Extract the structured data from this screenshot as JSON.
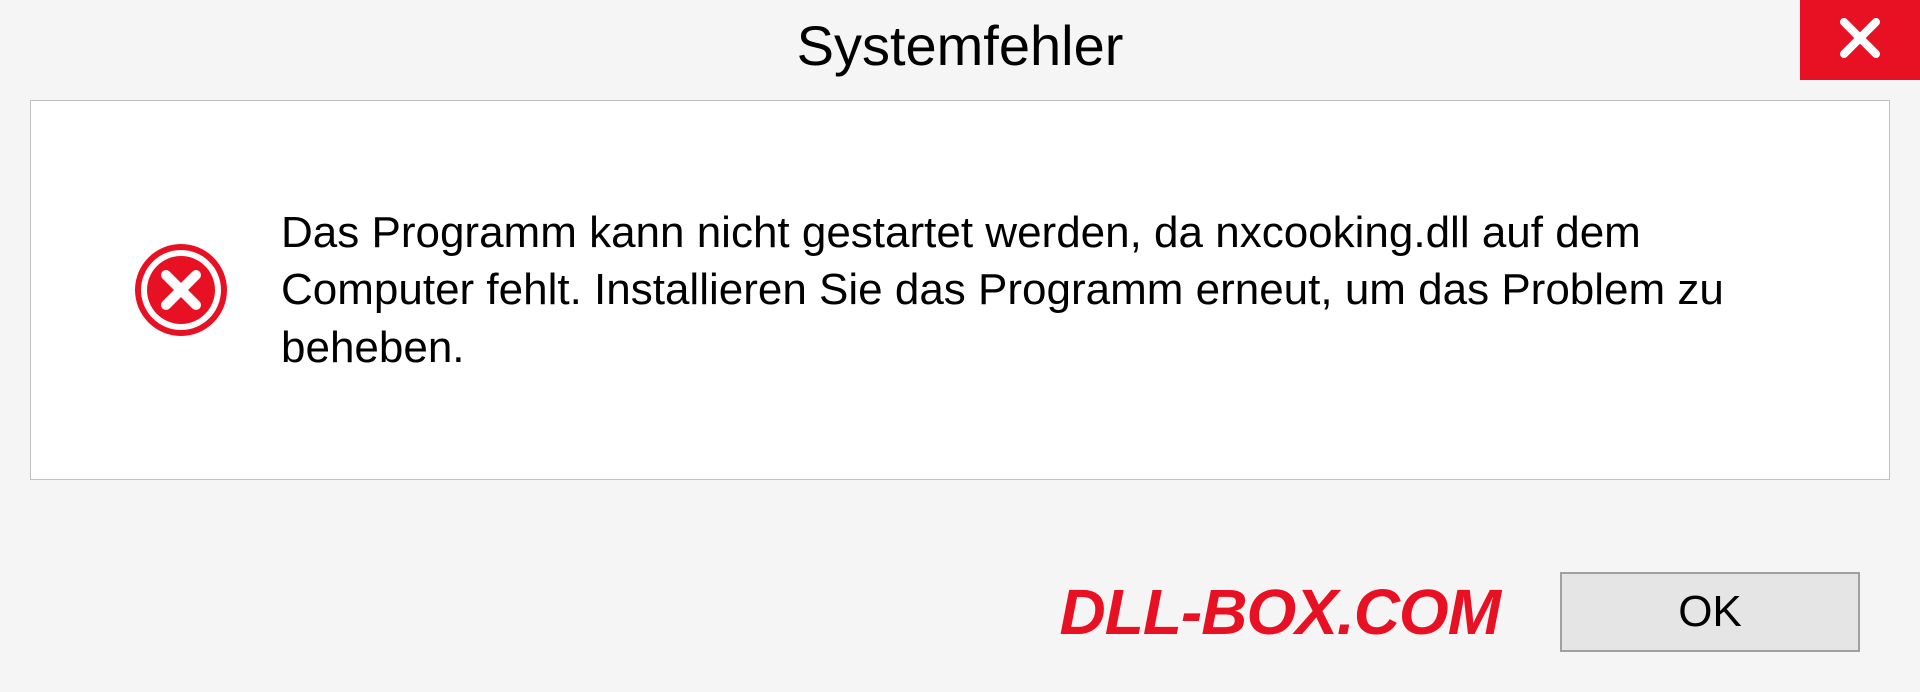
{
  "dialog": {
    "title": "Systemfehler",
    "message": "Das Programm kann nicht gestartet werden, da nxcooking.dll auf dem Computer fehlt. Installieren Sie das Programm erneut, um das Problem zu beheben.",
    "ok_label": "OK"
  },
  "watermark": "DLL-BOX.COM",
  "colors": {
    "error_red": "#e81123",
    "background": "#f5f5f5",
    "panel_bg": "#ffffff",
    "border": "#c0c0c0"
  }
}
